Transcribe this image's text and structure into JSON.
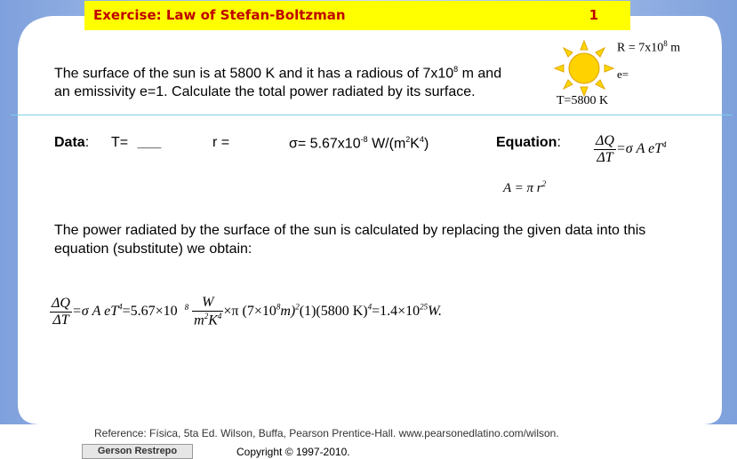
{
  "header": {
    "title": "Exercise: Law of Stefan-Boltzman",
    "page_number": "1"
  },
  "problem": {
    "line1_a": "The surface of the sun is at 5800 K and it has a radious of 7x10",
    "line1_exp": "8",
    "line1_b": " m and",
    "line2": "an emissivity e=1. Calculate the total power radiated by its surface."
  },
  "sun_labels": {
    "radius_a": "R = 7x10",
    "radius_exp": "8",
    "radius_b": " m",
    "emissivity": "e=",
    "temperature": "T=5800 K"
  },
  "data_row": {
    "label": "Data",
    "colon": ":",
    "t": "T=",
    "t_blank": "___",
    "r": "r  =",
    "sigma_a": "σ= 5.67x10",
    "sigma_exp": "-8",
    "sigma_b": " W/(m",
    "sigma_exp2": "2",
    "sigma_c": "K",
    "sigma_exp3": "4",
    "sigma_d": ")"
  },
  "equation": {
    "label": "Equation",
    "colon": ":",
    "num": "ΔQ",
    "den": "ΔT",
    "rhs": "=σ A eT",
    "rhs_exp": "4",
    "area": "A = π r",
    "area_exp": "2"
  },
  "paragraph2": "The power radiated by the surface of the sun is calculated by replacing the given data into this equation (substitute) we obtain:",
  "result": {
    "num": "ΔQ",
    "den": "ΔT",
    "part1": "=σ A eT",
    "exp4": "4",
    "part2": "=5.67×10",
    "exp8": "8",
    "unit_num": "W",
    "unit_den_a": "m",
    "unit_den_exp": "2",
    "unit_den_b": "K",
    "unit_den_exp2": "4",
    "part3": "×π (7×10",
    "exp8b": "8",
    "part4": "m)",
    "exp2": "2",
    "part5": "(1)(5800 K)",
    "exp4b": "4",
    "part6": "=1.4×10",
    "exp25": "25",
    "part7": "W."
  },
  "footer": {
    "reference": "Reference: Física, 5ta Ed. Wilson, Buffa, Pearson Prentice-Hall. www.pearsonedlatino.com/wilson.",
    "author": "Gerson Restrepo",
    "copyright": "Copyright © 1997-2010."
  },
  "colors": {
    "frame_blue": "#9db9e8",
    "title_bg": "#ffff00",
    "title_text": "#c00000",
    "sun": "#ffd700"
  }
}
